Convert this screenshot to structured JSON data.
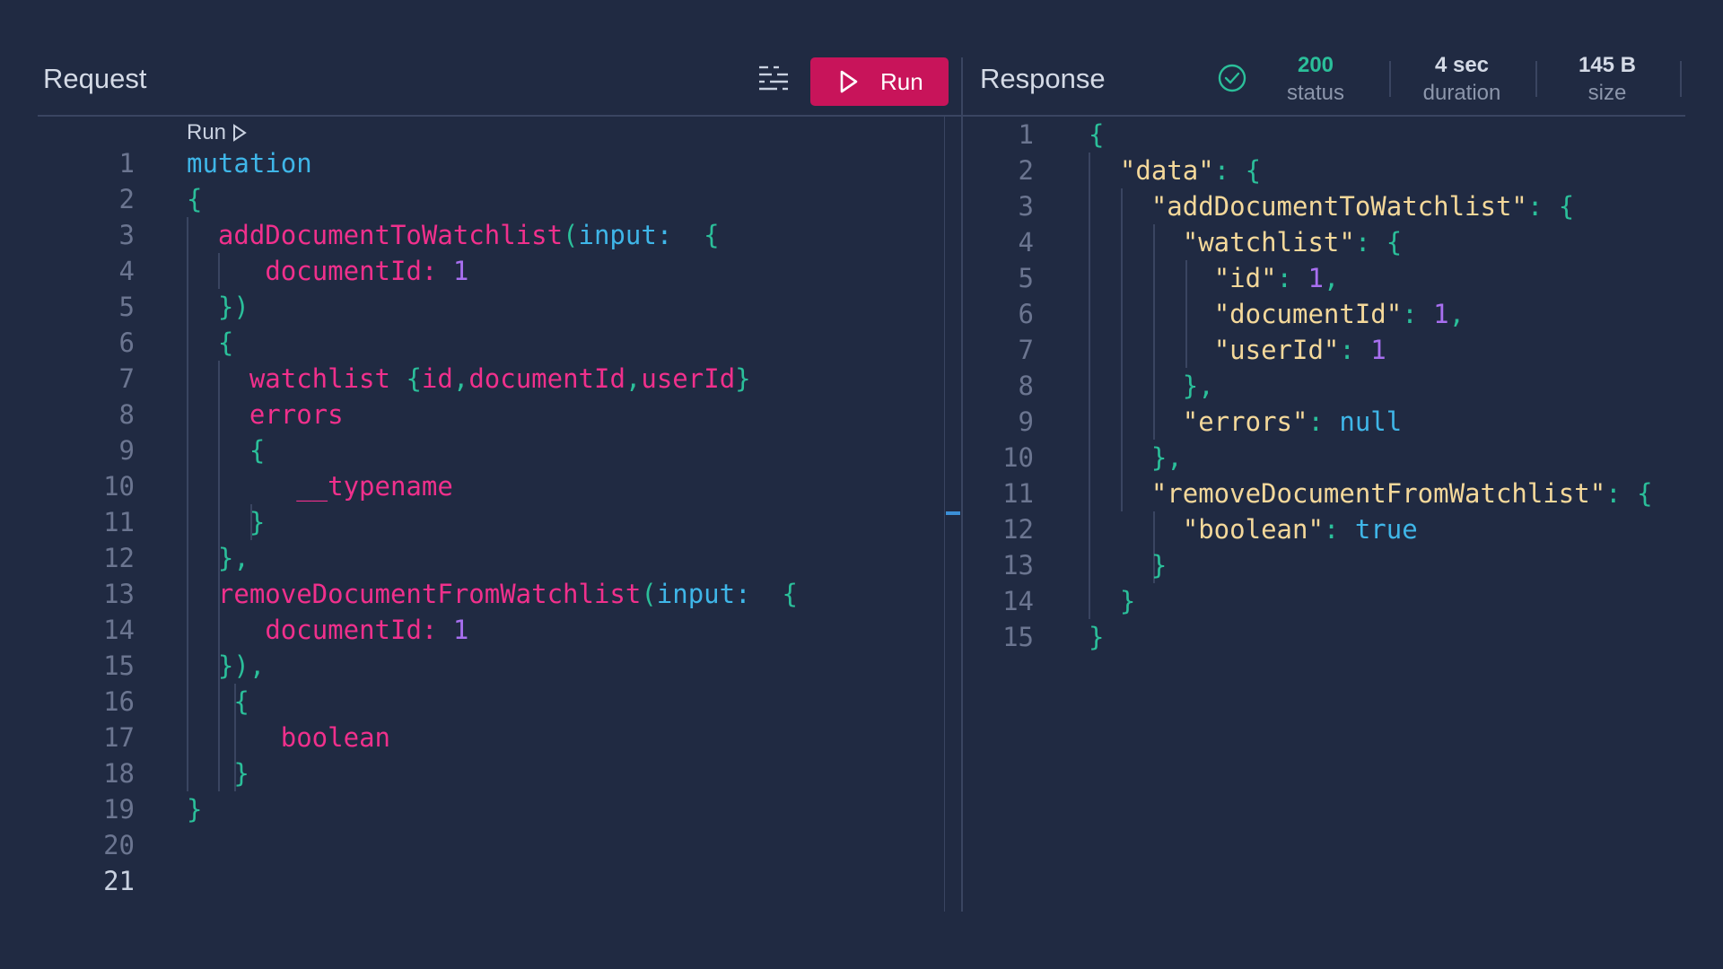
{
  "request": {
    "title": "Request",
    "run_button_label": "Run",
    "codelens_label": "Run",
    "code_lines": [
      [
        [
          "mutation",
          "k-blue"
        ]
      ],
      [
        [
          "{",
          "k-teal"
        ]
      ],
      [
        [
          "  ",
          ""
        ],
        [
          "addDocumentToWatchlist",
          "k-pink"
        ],
        [
          "(",
          "k-teal"
        ],
        [
          "input:",
          "k-blue"
        ],
        [
          "  {",
          "k-teal"
        ]
      ],
      [
        [
          "     ",
          ""
        ],
        [
          "documentId:",
          "k-pink"
        ],
        [
          " 1",
          "k-num"
        ]
      ],
      [
        [
          "  ",
          ""
        ],
        [
          "})",
          "k-teal"
        ]
      ],
      [
        [
          "  ",
          ""
        ],
        [
          "{",
          "k-teal"
        ]
      ],
      [
        [
          "    ",
          ""
        ],
        [
          "watchlist ",
          "k-pink"
        ],
        [
          "{",
          "k-teal"
        ],
        [
          "id",
          "k-pink"
        ],
        [
          ",",
          "k-teal"
        ],
        [
          "documentId",
          "k-pink"
        ],
        [
          ",",
          "k-teal"
        ],
        [
          "userId",
          "k-pink"
        ],
        [
          "}",
          "k-teal"
        ]
      ],
      [
        [
          "    ",
          ""
        ],
        [
          "errors",
          "k-pink"
        ]
      ],
      [
        [
          "    ",
          ""
        ],
        [
          "{",
          "k-teal"
        ]
      ],
      [
        [
          "       ",
          ""
        ],
        [
          "__typename",
          "k-pink"
        ]
      ],
      [
        [
          "    ",
          ""
        ],
        [
          "}",
          "k-teal"
        ]
      ],
      [
        [
          "  ",
          ""
        ],
        [
          "},",
          "k-teal"
        ]
      ],
      [
        [
          "  ",
          ""
        ],
        [
          "removeDocumentFromWatchlist",
          "k-pink"
        ],
        [
          "(",
          "k-teal"
        ],
        [
          "input:",
          "k-blue"
        ],
        [
          "  {",
          "k-teal"
        ]
      ],
      [
        [
          "     ",
          ""
        ],
        [
          "documentId:",
          "k-pink"
        ],
        [
          " 1",
          "k-num"
        ]
      ],
      [
        [
          "  ",
          ""
        ],
        [
          "}),",
          "k-teal"
        ]
      ],
      [
        [
          "   ",
          ""
        ],
        [
          "{",
          "k-teal"
        ]
      ],
      [
        [
          "      ",
          ""
        ],
        [
          "boolean",
          "k-pink"
        ]
      ],
      [
        [
          "   ",
          ""
        ],
        [
          "}",
          "k-teal"
        ]
      ],
      [
        [
          "}",
          "k-teal"
        ]
      ],
      [],
      []
    ]
  },
  "response": {
    "title": "Response",
    "status_value": "200",
    "status_label": "status",
    "duration_value": "4 sec",
    "duration_label": "duration",
    "size_value": "145 B",
    "size_label": "size",
    "code_lines": [
      [
        [
          "{",
          "k-teal"
        ]
      ],
      [
        [
          "  ",
          ""
        ],
        [
          "\"data\"",
          "k-str"
        ],
        [
          ": ",
          "k-teal"
        ],
        [
          "{",
          "k-teal"
        ]
      ],
      [
        [
          "    ",
          ""
        ],
        [
          "\"addDocumentToWatchlist\"",
          "k-str"
        ],
        [
          ": ",
          "k-teal"
        ],
        [
          "{",
          "k-teal"
        ]
      ],
      [
        [
          "      ",
          ""
        ],
        [
          "\"watchlist\"",
          "k-str"
        ],
        [
          ": ",
          "k-teal"
        ],
        [
          "{",
          "k-teal"
        ]
      ],
      [
        [
          "        ",
          ""
        ],
        [
          "\"id\"",
          "k-str"
        ],
        [
          ": ",
          "k-teal"
        ],
        [
          "1",
          "k-num"
        ],
        [
          ",",
          "k-teal"
        ]
      ],
      [
        [
          "        ",
          ""
        ],
        [
          "\"documentId\"",
          "k-str"
        ],
        [
          ": ",
          "k-teal"
        ],
        [
          "1",
          "k-num"
        ],
        [
          ",",
          "k-teal"
        ]
      ],
      [
        [
          "        ",
          ""
        ],
        [
          "\"userId\"",
          "k-str"
        ],
        [
          ": ",
          "k-teal"
        ],
        [
          "1",
          "k-num"
        ]
      ],
      [
        [
          "      ",
          ""
        ],
        [
          "},",
          "k-teal"
        ]
      ],
      [
        [
          "      ",
          ""
        ],
        [
          "\"errors\"",
          "k-str"
        ],
        [
          ": ",
          "k-teal"
        ],
        [
          "null",
          "k-blue"
        ]
      ],
      [
        [
          "    ",
          ""
        ],
        [
          "},",
          "k-teal"
        ]
      ],
      [
        [
          "    ",
          ""
        ],
        [
          "\"removeDocumentFromWatchlist\"",
          "k-str"
        ],
        [
          ": ",
          "k-teal"
        ],
        [
          "{",
          "k-teal"
        ]
      ],
      [
        [
          "      ",
          ""
        ],
        [
          "\"boolean\"",
          "k-str"
        ],
        [
          ": ",
          "k-teal"
        ],
        [
          "true",
          "k-blue"
        ]
      ],
      [
        [
          "    ",
          ""
        ],
        [
          "}",
          "k-teal"
        ]
      ],
      [
        [
          "  ",
          ""
        ],
        [
          "}",
          "k-teal"
        ]
      ],
      [
        [
          "}",
          "k-teal"
        ]
      ]
    ]
  },
  "colors": {
    "background": "#202a42",
    "run_button": "#c8145a",
    "status_ok": "#2bbf9a"
  },
  "icons": [
    "prettify-icon",
    "play-icon",
    "check-circle-icon"
  ]
}
